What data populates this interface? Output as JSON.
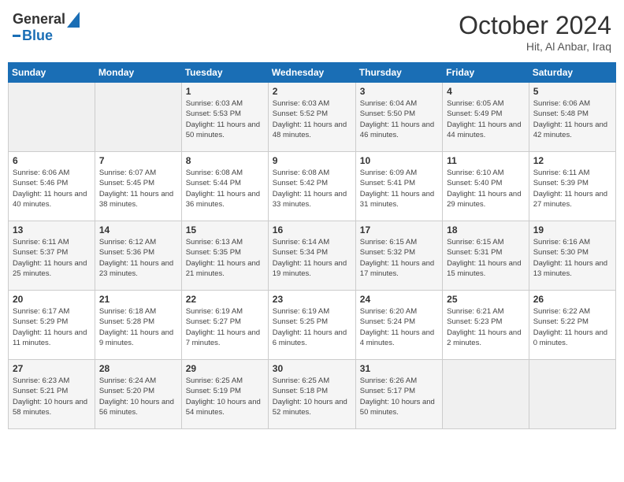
{
  "header": {
    "logo_general": "General",
    "logo_blue": "Blue",
    "month_year": "October 2024",
    "location": "Hit, Al Anbar, Iraq"
  },
  "days_of_week": [
    "Sunday",
    "Monday",
    "Tuesday",
    "Wednesday",
    "Thursday",
    "Friday",
    "Saturday"
  ],
  "weeks": [
    [
      {
        "day": "",
        "info": ""
      },
      {
        "day": "",
        "info": ""
      },
      {
        "day": "1",
        "info": "Sunrise: 6:03 AM\nSunset: 5:53 PM\nDaylight: 11 hours and 50 minutes."
      },
      {
        "day": "2",
        "info": "Sunrise: 6:03 AM\nSunset: 5:52 PM\nDaylight: 11 hours and 48 minutes."
      },
      {
        "day": "3",
        "info": "Sunrise: 6:04 AM\nSunset: 5:50 PM\nDaylight: 11 hours and 46 minutes."
      },
      {
        "day": "4",
        "info": "Sunrise: 6:05 AM\nSunset: 5:49 PM\nDaylight: 11 hours and 44 minutes."
      },
      {
        "day": "5",
        "info": "Sunrise: 6:06 AM\nSunset: 5:48 PM\nDaylight: 11 hours and 42 minutes."
      }
    ],
    [
      {
        "day": "6",
        "info": "Sunrise: 6:06 AM\nSunset: 5:46 PM\nDaylight: 11 hours and 40 minutes."
      },
      {
        "day": "7",
        "info": "Sunrise: 6:07 AM\nSunset: 5:45 PM\nDaylight: 11 hours and 38 minutes."
      },
      {
        "day": "8",
        "info": "Sunrise: 6:08 AM\nSunset: 5:44 PM\nDaylight: 11 hours and 36 minutes."
      },
      {
        "day": "9",
        "info": "Sunrise: 6:08 AM\nSunset: 5:42 PM\nDaylight: 11 hours and 33 minutes."
      },
      {
        "day": "10",
        "info": "Sunrise: 6:09 AM\nSunset: 5:41 PM\nDaylight: 11 hours and 31 minutes."
      },
      {
        "day": "11",
        "info": "Sunrise: 6:10 AM\nSunset: 5:40 PM\nDaylight: 11 hours and 29 minutes."
      },
      {
        "day": "12",
        "info": "Sunrise: 6:11 AM\nSunset: 5:39 PM\nDaylight: 11 hours and 27 minutes."
      }
    ],
    [
      {
        "day": "13",
        "info": "Sunrise: 6:11 AM\nSunset: 5:37 PM\nDaylight: 11 hours and 25 minutes."
      },
      {
        "day": "14",
        "info": "Sunrise: 6:12 AM\nSunset: 5:36 PM\nDaylight: 11 hours and 23 minutes."
      },
      {
        "day": "15",
        "info": "Sunrise: 6:13 AM\nSunset: 5:35 PM\nDaylight: 11 hours and 21 minutes."
      },
      {
        "day": "16",
        "info": "Sunrise: 6:14 AM\nSunset: 5:34 PM\nDaylight: 11 hours and 19 minutes."
      },
      {
        "day": "17",
        "info": "Sunrise: 6:15 AM\nSunset: 5:32 PM\nDaylight: 11 hours and 17 minutes."
      },
      {
        "day": "18",
        "info": "Sunrise: 6:15 AM\nSunset: 5:31 PM\nDaylight: 11 hours and 15 minutes."
      },
      {
        "day": "19",
        "info": "Sunrise: 6:16 AM\nSunset: 5:30 PM\nDaylight: 11 hours and 13 minutes."
      }
    ],
    [
      {
        "day": "20",
        "info": "Sunrise: 6:17 AM\nSunset: 5:29 PM\nDaylight: 11 hours and 11 minutes."
      },
      {
        "day": "21",
        "info": "Sunrise: 6:18 AM\nSunset: 5:28 PM\nDaylight: 11 hours and 9 minutes."
      },
      {
        "day": "22",
        "info": "Sunrise: 6:19 AM\nSunset: 5:27 PM\nDaylight: 11 hours and 7 minutes."
      },
      {
        "day": "23",
        "info": "Sunrise: 6:19 AM\nSunset: 5:25 PM\nDaylight: 11 hours and 6 minutes."
      },
      {
        "day": "24",
        "info": "Sunrise: 6:20 AM\nSunset: 5:24 PM\nDaylight: 11 hours and 4 minutes."
      },
      {
        "day": "25",
        "info": "Sunrise: 6:21 AM\nSunset: 5:23 PM\nDaylight: 11 hours and 2 minutes."
      },
      {
        "day": "26",
        "info": "Sunrise: 6:22 AM\nSunset: 5:22 PM\nDaylight: 11 hours and 0 minutes."
      }
    ],
    [
      {
        "day": "27",
        "info": "Sunrise: 6:23 AM\nSunset: 5:21 PM\nDaylight: 10 hours and 58 minutes."
      },
      {
        "day": "28",
        "info": "Sunrise: 6:24 AM\nSunset: 5:20 PM\nDaylight: 10 hours and 56 minutes."
      },
      {
        "day": "29",
        "info": "Sunrise: 6:25 AM\nSunset: 5:19 PM\nDaylight: 10 hours and 54 minutes."
      },
      {
        "day": "30",
        "info": "Sunrise: 6:25 AM\nSunset: 5:18 PM\nDaylight: 10 hours and 52 minutes."
      },
      {
        "day": "31",
        "info": "Sunrise: 6:26 AM\nSunset: 5:17 PM\nDaylight: 10 hours and 50 minutes."
      },
      {
        "day": "",
        "info": ""
      },
      {
        "day": "",
        "info": ""
      }
    ]
  ]
}
